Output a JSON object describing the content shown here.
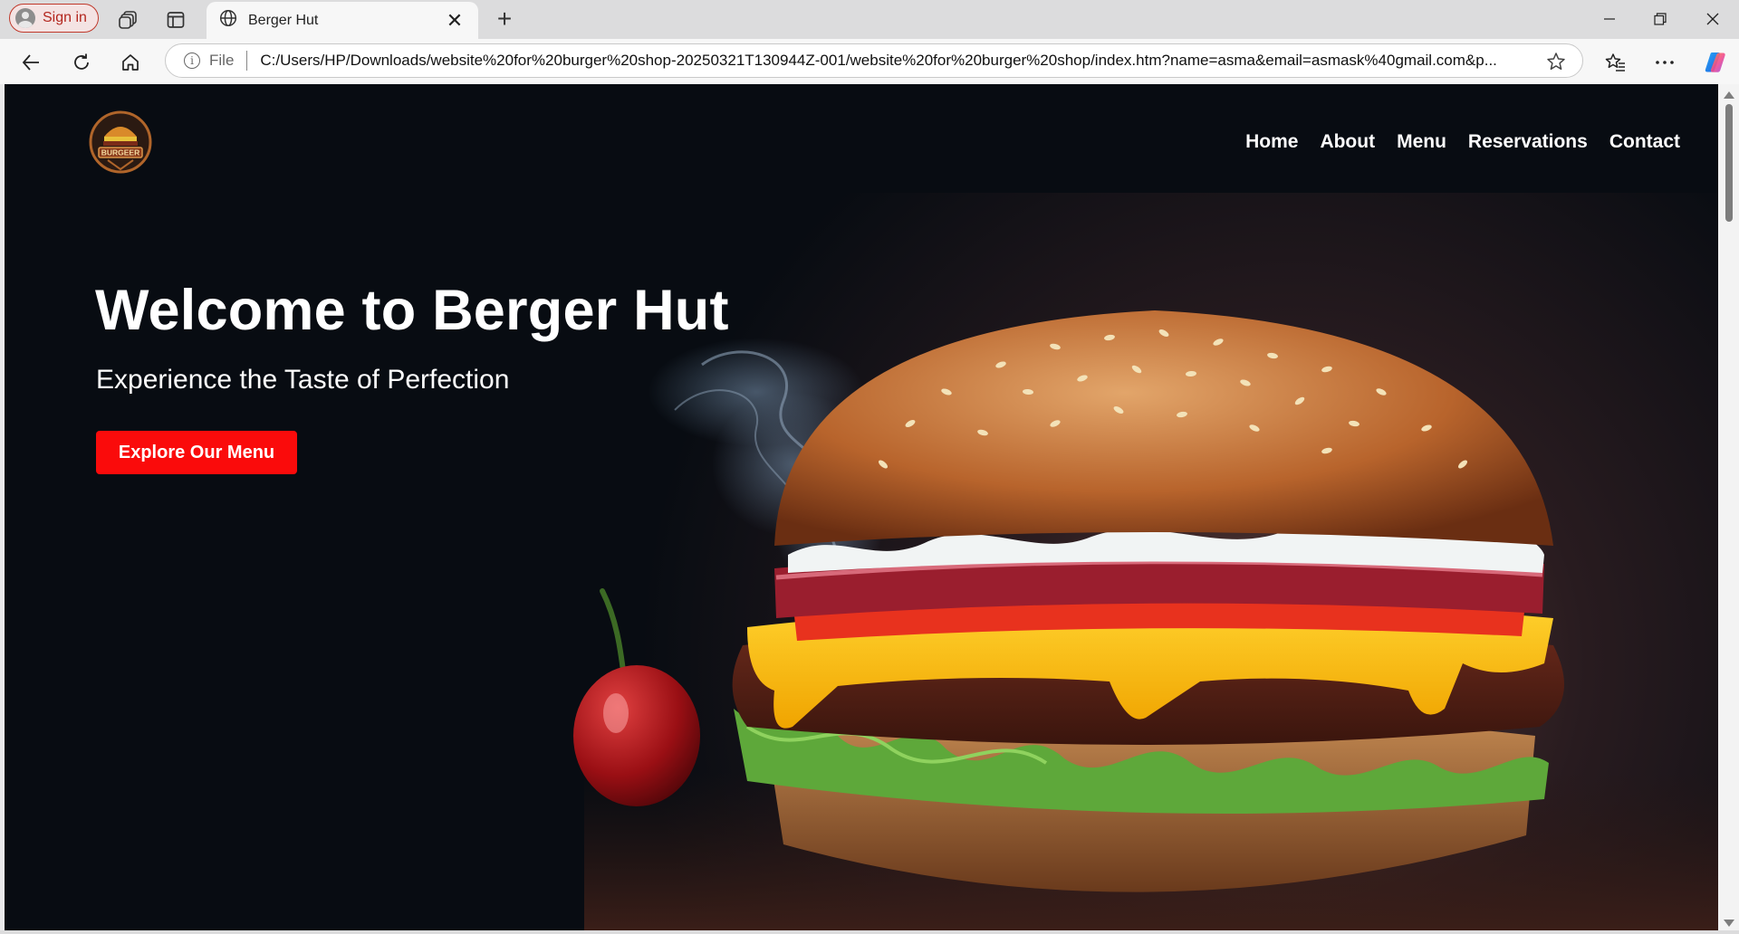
{
  "browser": {
    "signin_label": "Sign in",
    "tab_title": "Berger Hut",
    "address_scheme": "File",
    "url": "C:/Users/HP/Downloads/website%20for%20burger%20shop-20250321T130944Z-001/website%20for%20burger%20shop/index.htm?name=asma&email=asmask%40gmail.com&p..."
  },
  "site": {
    "logo_text": "BURGEER",
    "nav": [
      "Home",
      "About",
      "Menu",
      "Reservations",
      "Contact"
    ],
    "hero": {
      "title": "Welcome to Berger Hut",
      "subtitle": "Experience the Taste of Perfection",
      "cta": "Explore Our Menu"
    }
  },
  "colors": {
    "accent": "#fa0b0b",
    "hero_bg": "#080c12",
    "signin_border": "#c0392b"
  },
  "icons": [
    "workspaces-icon",
    "tab-actions-icon",
    "globe-icon",
    "back-icon",
    "refresh-icon",
    "home-icon",
    "info-icon",
    "favorite-star-icon",
    "favorites-icon",
    "more-icon",
    "copilot-icon"
  ]
}
